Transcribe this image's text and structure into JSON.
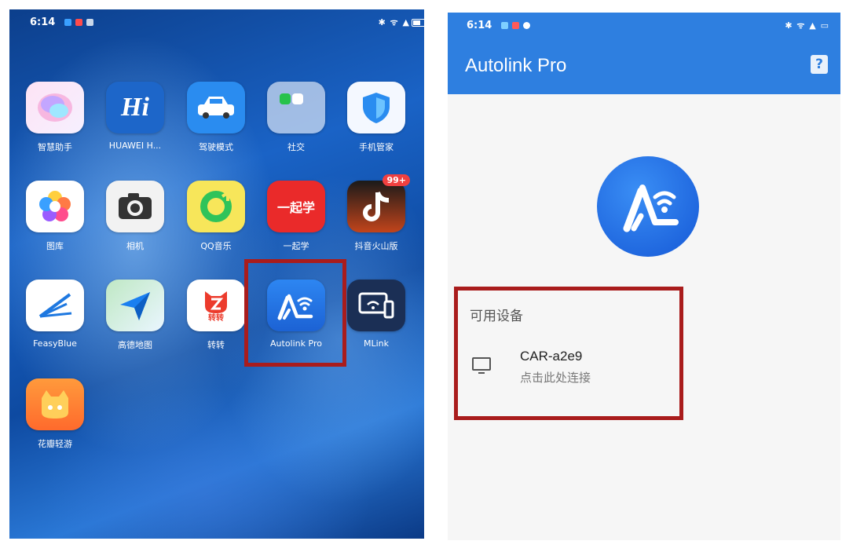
{
  "left_screen": {
    "status_time": "6:14",
    "apps": [
      {
        "label": "智慧助手"
      },
      {
        "label": "HUAWEI H..."
      },
      {
        "label": "驾驶模式"
      },
      {
        "label": "社交"
      },
      {
        "label": "手机管家"
      },
      {
        "label": "图库"
      },
      {
        "label": "相机"
      },
      {
        "label": "QQ音乐"
      },
      {
        "label": "一起学",
        "icon_text": "一起学"
      },
      {
        "label": "抖音火山版",
        "badge": "99+"
      },
      {
        "label": "FeasyBlue"
      },
      {
        "label": "高德地图"
      },
      {
        "label": "转转",
        "icon_text": "转转"
      },
      {
        "label": "Autolink Pro"
      },
      {
        "label": "MLink"
      },
      {
        "label": "花瓣轻游"
      }
    ],
    "hi_text": "Hi"
  },
  "right_screen": {
    "status_time": "6:14",
    "app_title": "Autolink Pro",
    "help_icon": "?",
    "section_label": "可用设备",
    "device": {
      "name": "CAR-a2e9",
      "hint": "点击此处连接"
    }
  },
  "colors": {
    "accent_blue": "#2e7fe0",
    "highlight_red": "#a91c1c"
  }
}
